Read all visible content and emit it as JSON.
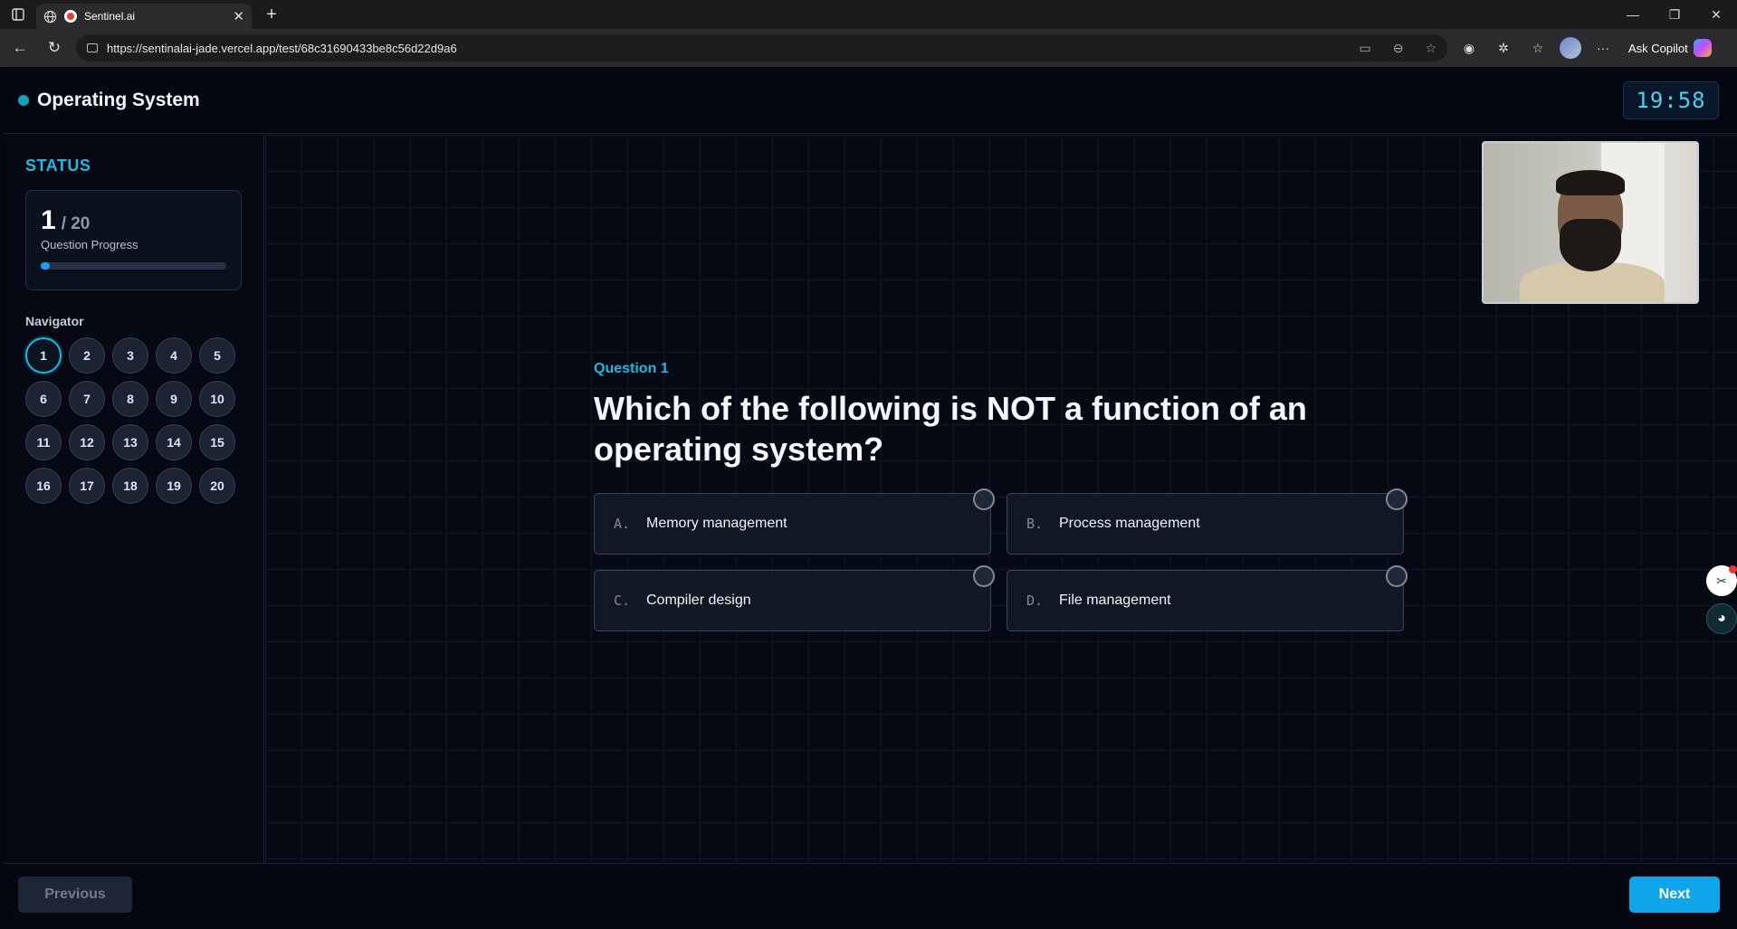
{
  "browser": {
    "tab_title": "Sentinel.ai",
    "url": "https://sentinalai-jade.vercel.app/test/68c31690433be8c56d22d9a6",
    "copilot_label": "Ask Copilot",
    "icons": [
      "window-icon",
      "globe-icon",
      "close-tab-icon",
      "new-tab-icon",
      "back-icon",
      "refresh-icon",
      "lock-icon",
      "camera-icon",
      "reader-icon",
      "favorite-icon",
      "extension-icon",
      "favorites-icon",
      "profile-icon",
      "more-icon"
    ]
  },
  "header": {
    "subject": "Operating System",
    "timer": "19:58"
  },
  "sidebar": {
    "status_heading": "STATUS",
    "current": "1",
    "total": "/ 20",
    "progress_label": "Question Progress",
    "progress_fraction": 0.05,
    "navigator_heading": "Navigator",
    "questions": [
      "1",
      "2",
      "3",
      "4",
      "5",
      "6",
      "7",
      "8",
      "9",
      "10",
      "11",
      "12",
      "13",
      "14",
      "15",
      "16",
      "17",
      "18",
      "19",
      "20"
    ],
    "active_question": "1"
  },
  "question": {
    "label": "Question 1",
    "text": "Which of the following is NOT a function of an operating system?",
    "options": [
      {
        "letter": "A.",
        "text": "Memory management"
      },
      {
        "letter": "B.",
        "text": "Process management"
      },
      {
        "letter": "C.",
        "text": "Compiler design"
      },
      {
        "letter": "D.",
        "text": "File management"
      }
    ]
  },
  "footer": {
    "previous_label": "Previous",
    "next_label": "Next"
  },
  "colors": {
    "accent": "#0ea5e9",
    "timer_text": "#4fd0ea",
    "background": "#060913"
  }
}
